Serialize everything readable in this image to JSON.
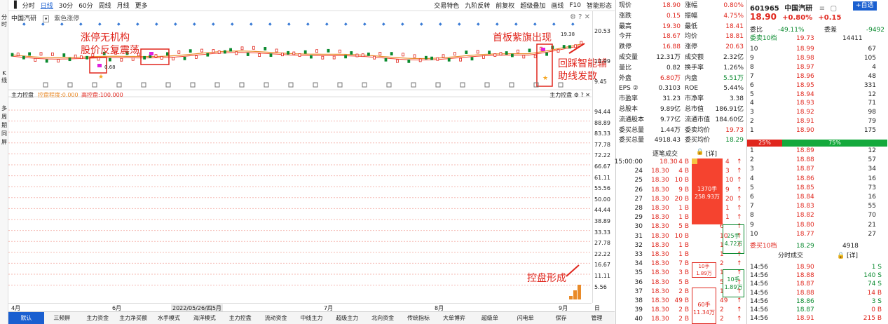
{
  "left_sidebar": {
    "items": [
      "分",
      "时",
      "K",
      "线",
      "多",
      "周",
      "期",
      "同",
      "屏"
    ]
  },
  "toolbar": {
    "left": [
      "分时",
      "日线",
      "30分",
      "60分",
      "周线",
      "月线",
      "更多"
    ],
    "active": "日线",
    "right": [
      "交易特色",
      "九阶反转",
      "前复权",
      "超级叠加",
      "画线",
      "F10",
      "智能形态"
    ]
  },
  "chart_header": {
    "name": "中国汽研",
    "indicator": "紫色涨停"
  },
  "sub_header": {
    "title": "主力控盘",
    "l1": "控盘程度:0.000",
    "l2": "高控盘:100.000"
  },
  "sub_header_right": "主力控盘",
  "annotations": {
    "a1_l1": "涨停无机构",
    "a1_l2": "股价反复震荡",
    "a2": "首板紫旗出现",
    "a3_l1": "回踩智能辅",
    "a3_l2": "助线发散",
    "a4": "控盘形成"
  },
  "price_labels": {
    "low": "0.68",
    "high": "19.38"
  },
  "y_axis_main": [
    "20.53",
    "14.99",
    "9.45"
  ],
  "y_axis_sub": [
    "94.44",
    "88.89",
    "83.33",
    "77.78",
    "72.22",
    "66.67",
    "61.11",
    "55.56",
    "50.00",
    "44.44",
    "38.89",
    "33.33",
    "27.78",
    "22.22",
    "16.67",
    "11.11",
    "5.56"
  ],
  "x_axis": {
    "labels": [
      "4月",
      "6月",
      "7月",
      "8月",
      "9月"
    ],
    "cursor": "2022/05/26/四",
    "cursor_tail": "5月",
    "right": "日线"
  },
  "bottom_tabs": [
    "默认",
    "三频屏",
    "主力资金",
    "主力净买额",
    "水手模式",
    "海洋模式",
    "主力控盘",
    "流动资金",
    "中线主力",
    "超级主力",
    "北向资金",
    "传统指标",
    "大单博弈",
    "超级单",
    "闪电单",
    "保存",
    "管理"
  ],
  "bottom_tab_selected": "默认",
  "quote": [
    [
      "现价",
      "18.90",
      "涨幅",
      "0.80%"
    ],
    [
      "涨跌",
      "0.15",
      "振幅",
      "4.75%"
    ],
    [
      "最高",
      "19.30",
      "最低",
      "18.41"
    ],
    [
      "今开",
      "18.67",
      "均价",
      "18.81"
    ],
    [
      "跌停",
      "16.88",
      "涨停",
      "20.63"
    ],
    [
      "成交量",
      "12.31万",
      "成交额",
      "2.32亿"
    ],
    [
      "量比",
      "0.82",
      "换手率",
      "1.26%"
    ],
    [
      "外盘",
      "6.80万",
      "内盘",
      "5.51万"
    ],
    [
      "EPS ②",
      "0.3103",
      "ROE",
      "5.44%"
    ],
    [
      "市盈率",
      "31.23",
      "市净率",
      "3.38"
    ],
    [
      "总股本",
      "9.89亿",
      "总市值",
      "186.91亿"
    ],
    [
      "流通股本",
      "9.77亿",
      "流通市值",
      "184.60亿"
    ],
    [
      "委买总量",
      "1.44万",
      "委卖均价",
      "19.73"
    ],
    [
      "委买总量",
      "4918.43",
      "委买均价",
      "18.29"
    ]
  ],
  "trades_header": "逐笔成交",
  "trades_lock": "[详]",
  "trades": [
    [
      "15:00:00",
      "18.30",
      "4 B",
      "4"
    ],
    [
      "24",
      "18.30",
      "4 B",
      "3"
    ],
    [
      "25",
      "18.30",
      "10 B",
      "10"
    ],
    [
      "26",
      "18.30",
      "9 B",
      "9"
    ],
    [
      "27",
      "18.30",
      "20 B",
      "20"
    ],
    [
      "28",
      "18.30",
      "1 B",
      "1"
    ],
    [
      "29",
      "18.30",
      "1 B",
      "1"
    ],
    [
      "30",
      "18.30",
      "5 B",
      "6"
    ],
    [
      "31",
      "18.30",
      "10 B",
      "10"
    ],
    [
      "32",
      "18.30",
      "1 B",
      "1"
    ],
    [
      "33",
      "18.30",
      "1 B",
      "1"
    ],
    [
      "34",
      "18.30",
      "7 B",
      "2"
    ],
    [
      "35",
      "18.30",
      "3 B",
      "1"
    ],
    [
      "36",
      "18.30",
      "5 B",
      "5"
    ],
    [
      "37",
      "18.30",
      "2 B",
      "1"
    ],
    [
      "38",
      "18.30",
      "49 B",
      "49"
    ],
    [
      "39",
      "18.30",
      "2 B",
      "2"
    ],
    [
      "40",
      "18.30",
      "2 B",
      "2"
    ]
  ],
  "trade_blocks": [
    {
      "l1": "1370手",
      "l2": "258.93万"
    },
    {
      "l1": "25手",
      "l2": "4.72万"
    },
    {
      "l1": "10手",
      "l2": "1.89万"
    },
    {
      "l1": "10手",
      "l2": "1.89万"
    },
    {
      "l1": "60手",
      "l2": "11.34万"
    }
  ],
  "stock": {
    "code": "601965",
    "name": "中国汽研",
    "btn_self": "+自选",
    "price": "18.90",
    "chg": "+0.80%",
    "chg_abs": "+0.15"
  },
  "wei": {
    "wb_label": "委比",
    "wb": "-49.11%",
    "wc_label": "委差",
    "wc": "-9492",
    "sell10_label": "委卖10档",
    "sell10_price": "19.73",
    "sell10_vol": "14411"
  },
  "asks": [
    [
      "10",
      "18.99",
      "67"
    ],
    [
      "9",
      "18.98",
      "105"
    ],
    [
      "8",
      "18.97",
      "4"
    ],
    [
      "7",
      "18.96",
      "48"
    ],
    [
      "6",
      "18.95",
      "331"
    ],
    [
      "5",
      "18.94",
      "12"
    ],
    [
      "4",
      "18.93",
      "71"
    ],
    [
      "3",
      "18.92",
      "98"
    ],
    [
      "2",
      "18.91",
      "79"
    ],
    [
      "1",
      "18.90",
      "175"
    ]
  ],
  "bar_pct": {
    "sell": "25%",
    "buy": "75%"
  },
  "bids": [
    [
      "1",
      "18.89",
      "12"
    ],
    [
      "2",
      "18.88",
      "57"
    ],
    [
      "3",
      "18.87",
      "34"
    ],
    [
      "4",
      "18.86",
      "16"
    ],
    [
      "5",
      "18.85",
      "73"
    ],
    [
      "6",
      "18.84",
      "16"
    ],
    [
      "7",
      "18.83",
      "55"
    ],
    [
      "8",
      "18.82",
      "70"
    ],
    [
      "9",
      "18.80",
      "21"
    ],
    [
      "10",
      "18.77",
      "27"
    ]
  ],
  "buy10": {
    "label": "委买10档",
    "price": "18.29",
    "vol": "4918"
  },
  "minute_header": "分时成交",
  "minute_detail": "[详]",
  "minute": [
    [
      "14:56",
      "18.90",
      "1 S"
    ],
    [
      "14:56",
      "18.88",
      "140 S"
    ],
    [
      "14:56",
      "18.87",
      "74 S"
    ],
    [
      "14:56",
      "18.88",
      "14 B"
    ],
    [
      "14:56",
      "18.86",
      "3 S"
    ],
    [
      "14:56",
      "18.87",
      "0 B"
    ],
    [
      "14:56",
      "18.91",
      "215 B"
    ]
  ],
  "colors": {
    "up": "#e0261d",
    "down": "#0a8a2f",
    "accent": "#1a5fd0",
    "band": "#f5432f",
    "ma": "#e98b2a"
  }
}
